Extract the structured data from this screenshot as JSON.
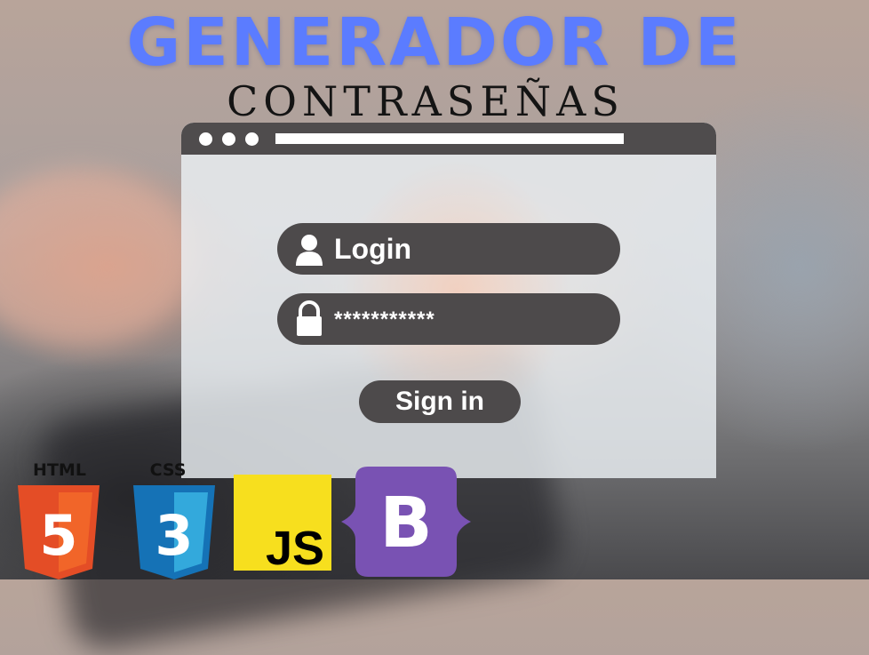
{
  "header": {
    "title": "GENERADOR DE",
    "subtitle": "CONTRASEÑAS"
  },
  "login_form": {
    "username_value": "Login",
    "password_value": "***********",
    "submit_label": "Sign in"
  },
  "tech_logos": [
    {
      "name": "html5-icon",
      "caption": "HTML",
      "glyph": "5",
      "color": "#e44d26"
    },
    {
      "name": "css3-icon",
      "caption": "CSS",
      "glyph": "3",
      "color": "#1572b6"
    },
    {
      "name": "javascript-icon",
      "caption": "",
      "glyph": "JS",
      "color": "#f7df1e"
    },
    {
      "name": "bootstrap-icon",
      "caption": "",
      "glyph": "B",
      "color": "#7952b3"
    }
  ]
}
